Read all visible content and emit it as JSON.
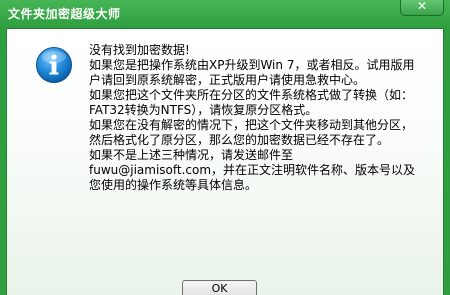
{
  "window": {
    "title": "文件夹加密超级大师",
    "close_label": "✕"
  },
  "icon": {
    "name": "info-icon",
    "color": "#1e88d6"
  },
  "message": {
    "lines": [
      "没有找到加密数据!",
      "如果您是把操作系统由XP升级到Win 7，或者相反。试用版用户请回到原系统解密，正式版用户请使用急救中心。",
      "如果您把这个文件夹所在分区的文件系统格式做了转换（如：FAT32转换为NTFS），请恢复原分区格式。",
      "如果您在没有解密的情况下，把这个文件夹移动到其他分区，然后格式化了原分区，那么您的加密数据已经不存在了。",
      "如果不是上述三种情况，请发送邮件至fuwu@jiamisoft.com，并在正文注明软件名称、版本号以及您使用的操作系统等具体信息。"
    ]
  },
  "buttons": {
    "ok_label": "OK"
  }
}
